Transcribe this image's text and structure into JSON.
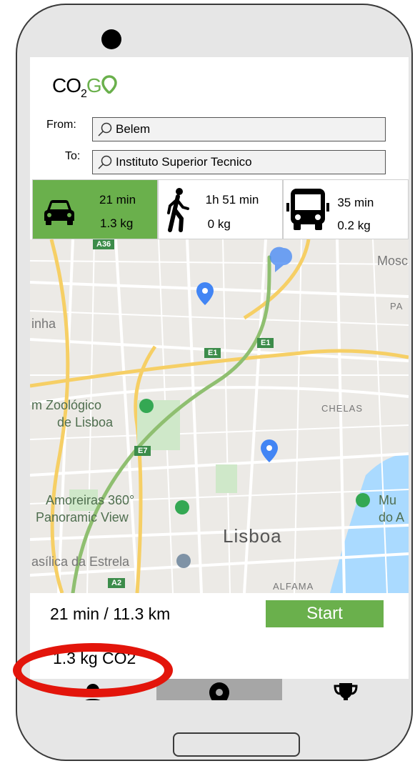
{
  "app": {
    "logo": {
      "co": "CO",
      "sub": "2",
      "g": "G"
    },
    "brand_color": "#6ab04c"
  },
  "search": {
    "from_label": "From:",
    "to_label": "To:",
    "from_value": "Belem",
    "to_value": "Instituto Superior Tecnico"
  },
  "modes": [
    {
      "name": "car",
      "icon": "car-icon",
      "time": "21 min",
      "co2": "1.3 kg",
      "selected": true
    },
    {
      "name": "walk",
      "icon": "walking-person-icon",
      "time": "1h 51 min",
      "co2": "0 kg",
      "selected": false
    },
    {
      "name": "bus",
      "icon": "bus-icon",
      "time": "35 min",
      "co2": "0.2 kg",
      "selected": false
    }
  ],
  "map": {
    "labels": {
      "a36": "A36",
      "mosc": "Mosc",
      "pa": "PA",
      "inha": "inha",
      "e1a": "E1",
      "e1b": "E1",
      "zoo1": "m Zoológico",
      "zoo2": "de Lisboa",
      "chelas": "CHELAS",
      "e7": "E7",
      "amor1": "Amoreiras 360°",
      "amor2": "Panoramic View",
      "mus1": "Mu",
      "mus2": "do A",
      "lisboa": "Lisboa",
      "basilica": "asílica da Estrela",
      "a2": "A2",
      "alfama": "ALFAMA"
    }
  },
  "route": {
    "summary": "21 min / 11.3 km",
    "co2": "1.3 kg CO2",
    "start_label": "Start"
  },
  "nav": {
    "items": [
      {
        "icon": "user-icon"
      },
      {
        "icon": "location-pin-icon",
        "active": true
      },
      {
        "icon": "trophy-icon"
      }
    ]
  },
  "highlight_color": "#e3150b"
}
